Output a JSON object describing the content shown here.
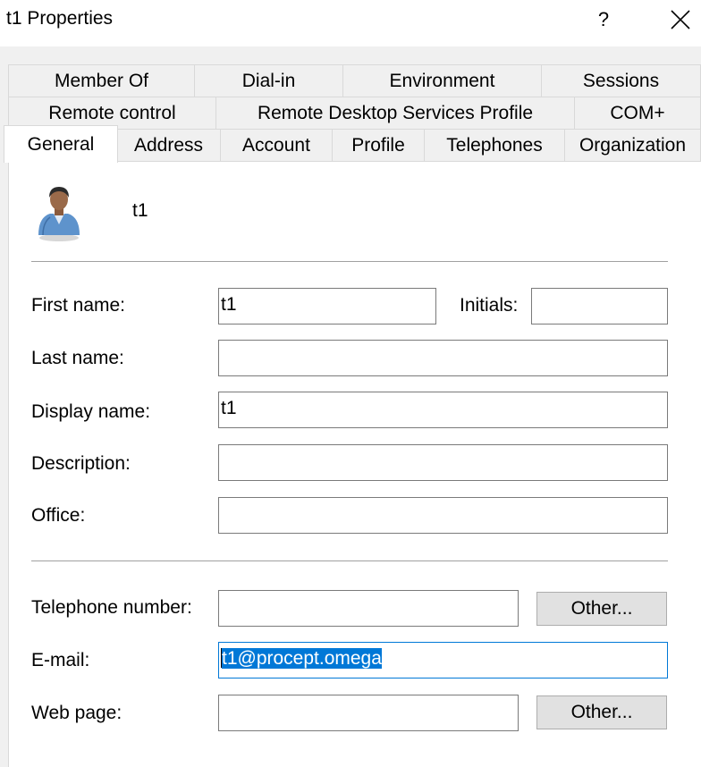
{
  "window": {
    "title": "t1 Properties",
    "help_label": "?"
  },
  "tabs": {
    "row1": [
      "Member Of",
      "Dial-in",
      "Environment",
      "Sessions"
    ],
    "row2": [
      "Remote control",
      "Remote Desktop Services Profile",
      "COM+"
    ],
    "row3": [
      "General",
      "Address",
      "Account",
      "Profile",
      "Telephones",
      "Organization"
    ],
    "selected": "General"
  },
  "user": {
    "name": "t1",
    "icon": "user-avatar-icon"
  },
  "fields": {
    "first_name": {
      "label": "First name:",
      "value": "t1"
    },
    "initials": {
      "label": "Initials:",
      "value": ""
    },
    "last_name": {
      "label": "Last name:",
      "value": ""
    },
    "display_name": {
      "label": "Display name:",
      "value": "t1"
    },
    "description": {
      "label": "Description:",
      "value": ""
    },
    "office": {
      "label": "Office:",
      "value": ""
    },
    "telephone": {
      "label": "Telephone number:",
      "value": ""
    },
    "email": {
      "label": "E-mail:",
      "value": "t1@procept.omega",
      "selected": true
    },
    "web_page": {
      "label": "Web page:",
      "value": ""
    }
  },
  "buttons": {
    "other_phone": "Other...",
    "other_web": "Other..."
  },
  "colors": {
    "selection": "#0078d7",
    "dialog_bg": "#f0f0f0",
    "button_bg": "#e1e1e1"
  }
}
